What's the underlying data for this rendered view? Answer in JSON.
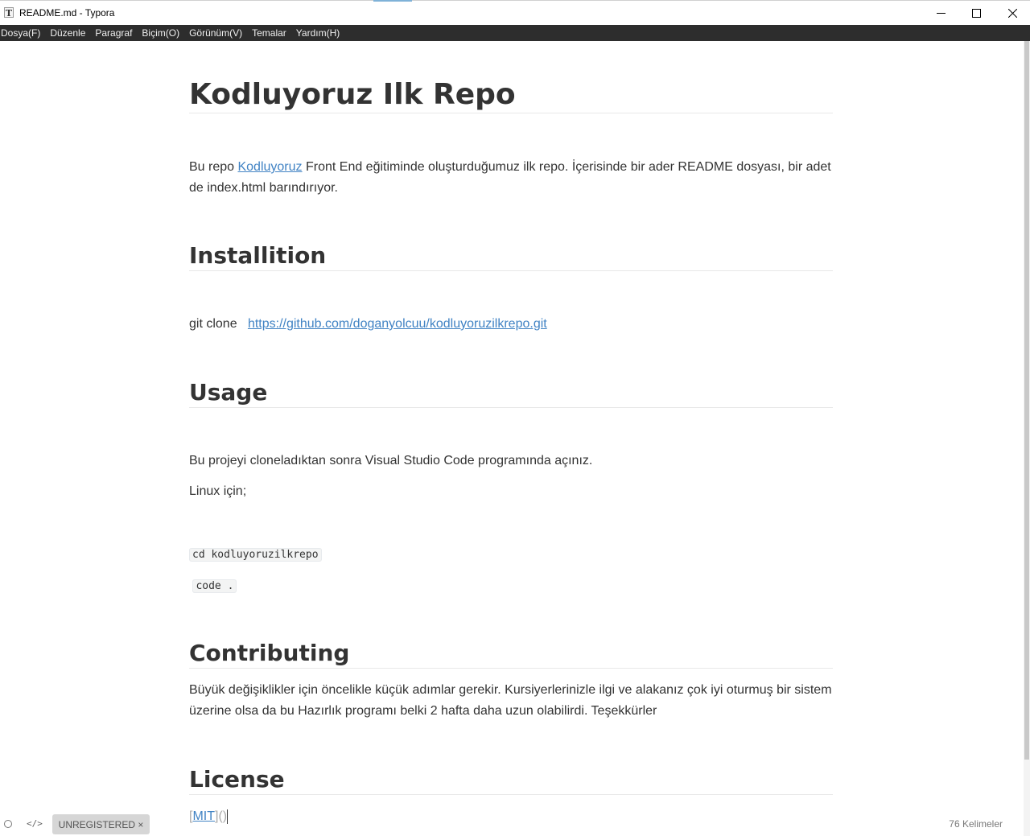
{
  "window": {
    "app_icon_letter": "T",
    "title": "README.md - Typora",
    "controls": [
      "minimize",
      "maximize",
      "close"
    ]
  },
  "menu": {
    "items": [
      "Dosya(F)",
      "Düzenle",
      "Paragraf",
      "Biçim(O)",
      "Görünüm(V)",
      "Temalar",
      "Yardım(H)"
    ]
  },
  "document": {
    "title": "Kodluyoruz Ilk Repo",
    "intro": {
      "before": "Bu repo ",
      "link": "Kodluyoruz",
      "after": " Front End eğitiminde oluşturduğumuz ilk repo. İçerisinde bir ader README dosyası, bir adet de index.html barındırıyor."
    },
    "installation": {
      "heading": "Installition",
      "prefix": "git clone ",
      "link": "https://github.com/doganyolcuu/kodluyoruzilkrepo.git"
    },
    "usage": {
      "heading": "Usage",
      "line1": "Bu projeyi cloneladıktan sonra Visual Studio Code programında açınız.",
      "line2": "Linux için;",
      "code1": "cd kodluyoruzilkrepo",
      "code2": "code ."
    },
    "contributing": {
      "heading": "Contributing",
      "text": "Büyük değişiklikler için öncelikle küçük adımlar gerekir. Kursiyerlerinizle ilgi ve alakanız çok iyi oturmuş bir sistem üzerine olsa da bu Hazırlık programı belki 2 hafta daha uzun olabilirdi. Teşekkürler"
    },
    "license": {
      "heading": "License",
      "open_bracket": "[",
      "link": "MIT",
      "close": "]()"
    }
  },
  "statusbar": {
    "code_toggle": "</>",
    "unregistered": "UNREGISTERED ×",
    "word_count": "76 Kelimeler"
  }
}
